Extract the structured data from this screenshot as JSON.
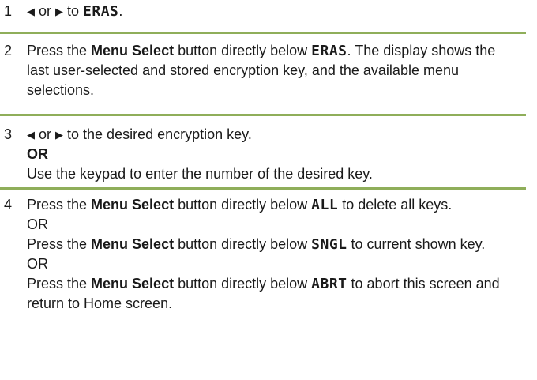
{
  "arrows": {
    "left": "◀",
    "right": "▶"
  },
  "steps": [
    {
      "num": "1",
      "or": " or ",
      "to": " to ",
      "lcd": "ERAS",
      "end": "."
    },
    {
      "num": "2",
      "press": "Press the ",
      "menu_select": "Menu Select",
      "below": " button directly below ",
      "lcd": "ERAS",
      "rest": ". The display shows the last user-selected and stored encryption key, and the available menu selections."
    },
    {
      "num": "3",
      "or": " or ",
      "to_desired": " to the desired encryption key.",
      "or_bold": "OR",
      "keypad": "Use the keypad to enter the number of the desired key."
    },
    {
      "num": "4",
      "opt1": {
        "press": "Press the ",
        "menu_select": "Menu Select",
        "below": " button directly below ",
        "lcd": "ALL",
        "rest": " to delete all keys."
      },
      "or1": "OR",
      "opt2": {
        "press": "Press the ",
        "menu_select": "Menu Select",
        "below": " button directly below ",
        "lcd": "SNGL",
        "rest": " to current shown key."
      },
      "or2": "OR",
      "opt3": {
        "press": "Press the ",
        "menu_select": "Menu Select",
        "below": " button directly below ",
        "lcd": "ABRT",
        "rest": " to abort this screen and return to Home screen."
      }
    }
  ]
}
